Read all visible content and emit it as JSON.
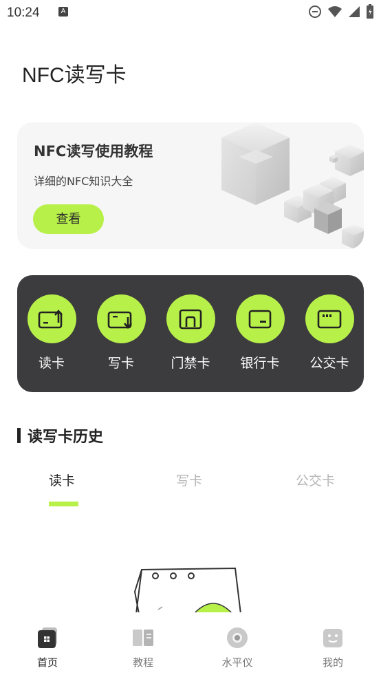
{
  "status_bar": {
    "time": "10:24",
    "notif_glyph": "A"
  },
  "header": {
    "title": "NFC读写卡"
  },
  "banner": {
    "title": "NFC读写使用教程",
    "subtitle": "详细的NFC知识大全",
    "button_label": "查看"
  },
  "quick_actions": [
    {
      "label": "读卡",
      "icon": "card-read-icon"
    },
    {
      "label": "写卡",
      "icon": "card-write-icon"
    },
    {
      "label": "门禁卡",
      "icon": "access-card-icon"
    },
    {
      "label": "银行卡",
      "icon": "bank-card-icon"
    },
    {
      "label": "公交卡",
      "icon": "bus-card-icon"
    }
  ],
  "history": {
    "title": "读写卡历史",
    "tabs": [
      {
        "label": "读卡",
        "active": true
      },
      {
        "label": "写卡",
        "active": false
      },
      {
        "label": "公交卡",
        "active": false
      }
    ]
  },
  "bottom_nav": [
    {
      "label": "首页",
      "icon": "home-icon",
      "active": true
    },
    {
      "label": "教程",
      "icon": "book-icon",
      "active": false
    },
    {
      "label": "水平仪",
      "icon": "level-icon",
      "active": false
    },
    {
      "label": "我的",
      "icon": "profile-icon",
      "active": false
    }
  ],
  "colors": {
    "accent": "#b8f04a",
    "panel": "#3c3c3e",
    "banner_bg": "#f6f6f6"
  }
}
